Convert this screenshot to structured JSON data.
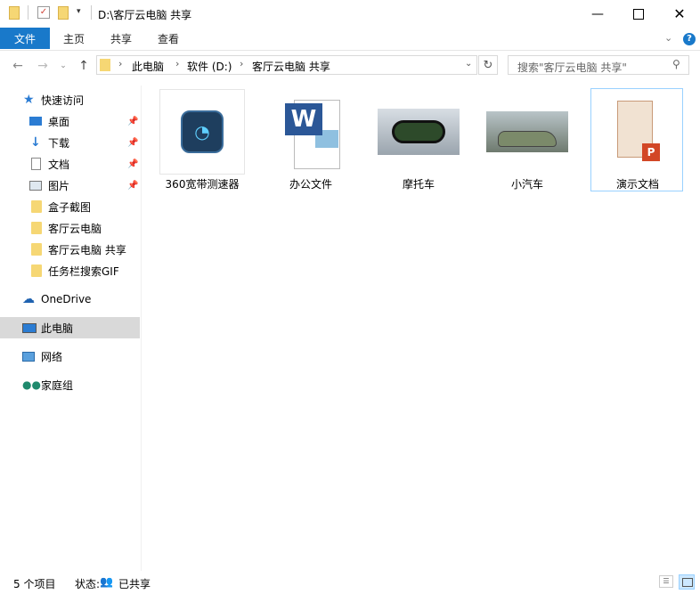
{
  "window": {
    "title": "D:\\客厅云电脑 共享",
    "min_icon": "minimize-icon",
    "max_icon": "maximize-icon",
    "close_icon": "close-icon"
  },
  "ribbon": {
    "tabs": [
      "文件",
      "主页",
      "共享",
      "查看"
    ]
  },
  "address": {
    "crumbs": [
      "此电脑",
      "软件 (D:)",
      "客厅云电脑 共享"
    ],
    "search_placeholder": "搜索\"客厅云电脑 共享\""
  },
  "nav": {
    "quick_access": "快速访问",
    "items": [
      {
        "label": "桌面",
        "pinned": true
      },
      {
        "label": "下载",
        "pinned": true
      },
      {
        "label": "文档",
        "pinned": true
      },
      {
        "label": "图片",
        "pinned": true
      },
      {
        "label": "盒子截图",
        "pinned": false
      },
      {
        "label": "客厅云电脑",
        "pinned": false
      },
      {
        "label": "客厅云电脑 共享",
        "pinned": false
      },
      {
        "label": "任务栏搜索GIF",
        "pinned": false
      }
    ],
    "onedrive": "OneDrive",
    "this_pc": "此电脑",
    "network": "网络",
    "homegroup": "家庭组"
  },
  "files": [
    {
      "name": "360宽带测速器",
      "icon": "speedometer-app-icon"
    },
    {
      "name": "办公文件",
      "icon": "word-document-icon"
    },
    {
      "name": "摩托车",
      "icon": "motorcycle-photo"
    },
    {
      "name": "小汽车",
      "icon": "car-photo"
    },
    {
      "name": "演示文档",
      "icon": "powerpoint-floorplan-icon"
    }
  ],
  "status": {
    "count": "5 个项目",
    "state_label": "状态:",
    "state_value": "已共享"
  },
  "colors": {
    "accent": "#1979ca",
    "selection": "#d9d9d9",
    "folder": "#f6d774"
  }
}
